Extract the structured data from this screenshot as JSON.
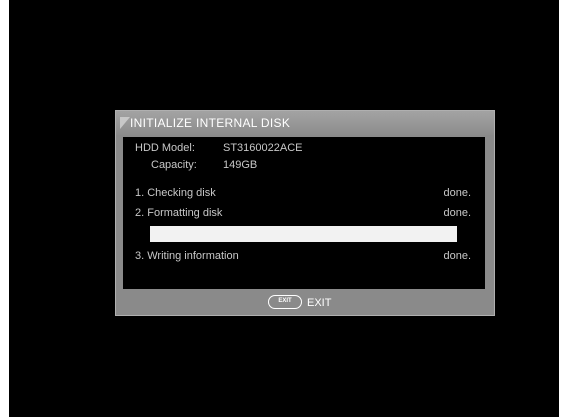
{
  "dialog": {
    "title": "INITIALIZE INTERNAL DISK",
    "hdd_model_label": "HDD  Model:",
    "hdd_model_value": "ST3160022ACE",
    "capacity_label": "Capacity:",
    "capacity_value": "149GB",
    "steps": [
      {
        "label": "1. Checking disk",
        "status": "done."
      },
      {
        "label": "2. Formatting disk",
        "status": "done."
      },
      {
        "label": "3. Writing information",
        "status": "done."
      }
    ],
    "progress": 1.0,
    "footer": {
      "exit_button_label": "EXIT",
      "exit_text": "EXIT"
    }
  },
  "colors": {
    "background": "#000000",
    "dialog_frame": "#8a8a8a",
    "text": "#c8c8c8",
    "progress_fill": "#f2f2f2"
  }
}
